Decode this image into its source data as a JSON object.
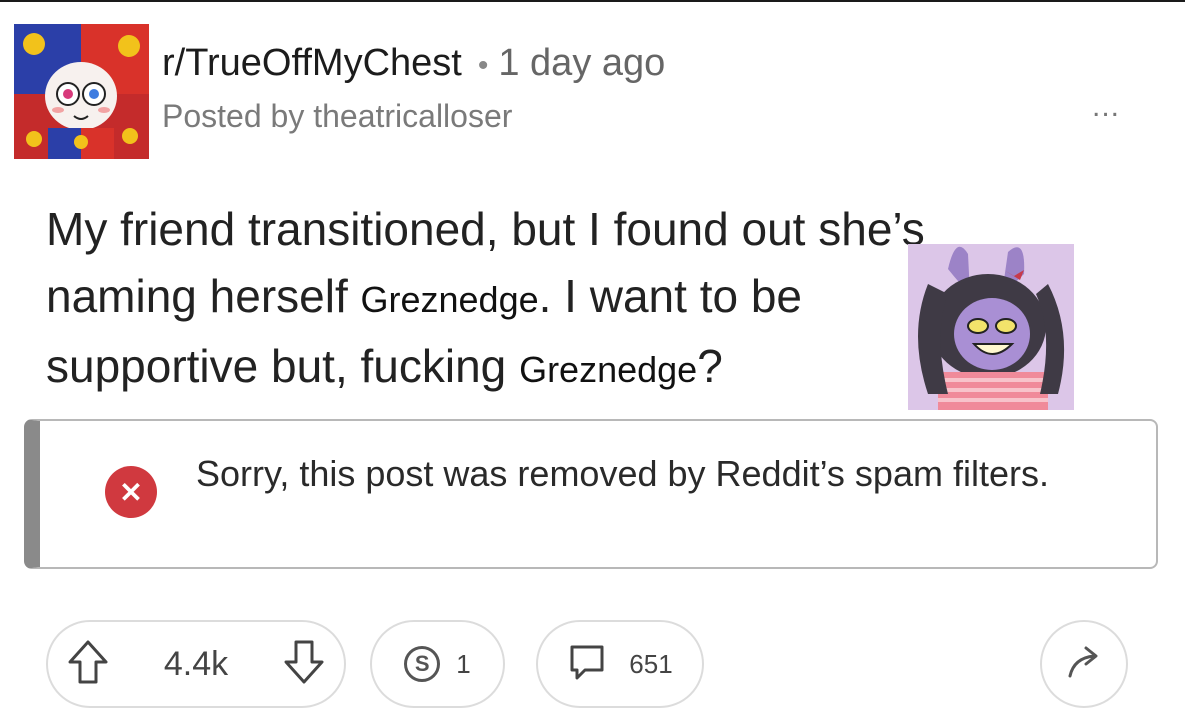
{
  "header": {
    "subreddit": "r/TrueOffMyChest",
    "separator": "•",
    "time_ago": "1 day ago",
    "posted_by": "Posted by theatricalloser",
    "more_label": "..."
  },
  "post": {
    "title_line1": "My friend transitioned, but I found out she’s",
    "title_line2_prefix": "naming herself",
    "name_1": "Greznedge",
    "title_line2_suffix": ". I want to be",
    "title_line3_prefix": "supportive but, fucking",
    "name_2": "Greznedge",
    "title_line3_suffix": "?"
  },
  "notice": {
    "icon": "x-icon",
    "text": "Sorry, this post was removed by Reddit’s spam filters."
  },
  "actions": {
    "votes": "4.4k",
    "awards": "1",
    "award_icon_glyph": "S",
    "comments": "651"
  },
  "colors": {
    "notice_icon": "#d0393f",
    "notice_bar": "#8a8a8a"
  }
}
